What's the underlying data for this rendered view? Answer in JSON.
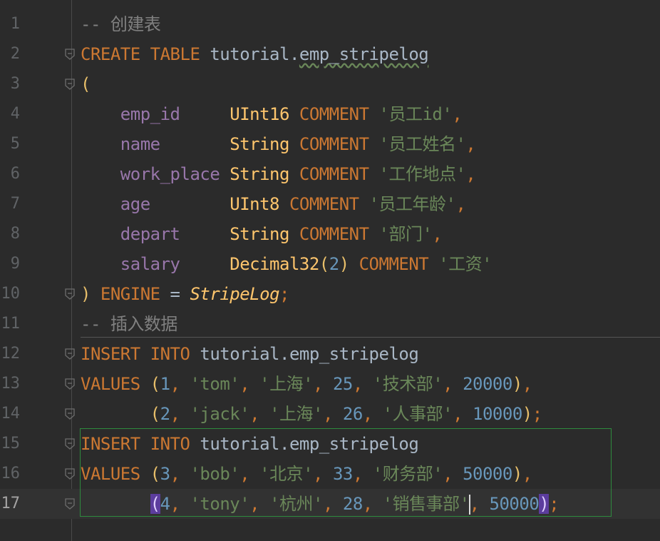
{
  "editor": {
    "current_line": 17,
    "lines": [
      {
        "n": "1",
        "tokens": [
          {
            "c": "cmt",
            "t": "-- 创建表"
          }
        ]
      },
      {
        "n": "2",
        "fold": true,
        "tokens": [
          {
            "c": "kw",
            "t": "CREATE"
          },
          {
            "t": " "
          },
          {
            "c": "kw",
            "t": "TABLE"
          },
          {
            "t": " tutorial."
          },
          {
            "c": "wavy",
            "t": "emp_stripelog"
          }
        ]
      },
      {
        "n": "3",
        "fold": true,
        "tokens": [
          {
            "c": "paren",
            "t": "("
          }
        ]
      },
      {
        "n": "4",
        "tokens": [
          {
            "t": "    "
          },
          {
            "c": "fld",
            "t": "emp_id"
          },
          {
            "t": "     "
          },
          {
            "c": "fn",
            "t": "UInt16"
          },
          {
            "t": " "
          },
          {
            "c": "kw",
            "t": "COMMENT"
          },
          {
            "t": " "
          },
          {
            "c": "str",
            "t": "'员工id'"
          },
          {
            "c": "kw",
            "t": ","
          }
        ]
      },
      {
        "n": "5",
        "tokens": [
          {
            "t": "    "
          },
          {
            "c": "fld",
            "t": "name"
          },
          {
            "t": "       "
          },
          {
            "c": "fn",
            "t": "String"
          },
          {
            "t": " "
          },
          {
            "c": "kw",
            "t": "COMMENT"
          },
          {
            "t": " "
          },
          {
            "c": "str",
            "t": "'员工姓名'"
          },
          {
            "c": "kw",
            "t": ","
          }
        ]
      },
      {
        "n": "6",
        "tokens": [
          {
            "t": "    "
          },
          {
            "c": "fld",
            "t": "work_place"
          },
          {
            "t": " "
          },
          {
            "c": "fn",
            "t": "String"
          },
          {
            "t": " "
          },
          {
            "c": "kw",
            "t": "COMMENT"
          },
          {
            "t": " "
          },
          {
            "c": "str",
            "t": "'工作地点'"
          },
          {
            "c": "kw",
            "t": ","
          }
        ]
      },
      {
        "n": "7",
        "tokens": [
          {
            "t": "    "
          },
          {
            "c": "fld",
            "t": "age"
          },
          {
            "t": "        "
          },
          {
            "c": "fn",
            "t": "UInt8"
          },
          {
            "t": " "
          },
          {
            "c": "kw",
            "t": "COMMENT"
          },
          {
            "t": " "
          },
          {
            "c": "str",
            "t": "'员工年龄'"
          },
          {
            "c": "kw",
            "t": ","
          }
        ]
      },
      {
        "n": "8",
        "tokens": [
          {
            "t": "    "
          },
          {
            "c": "fld",
            "t": "depart"
          },
          {
            "t": "     "
          },
          {
            "c": "fn",
            "t": "String"
          },
          {
            "t": " "
          },
          {
            "c": "kw",
            "t": "COMMENT"
          },
          {
            "t": " "
          },
          {
            "c": "str",
            "t": "'部门'"
          },
          {
            "c": "kw",
            "t": ","
          }
        ]
      },
      {
        "n": "9",
        "tokens": [
          {
            "t": "    "
          },
          {
            "c": "fld",
            "t": "salary"
          },
          {
            "t": "     "
          },
          {
            "c": "fn",
            "t": "Decimal32"
          },
          {
            "c": "paren",
            "t": "("
          },
          {
            "c": "num",
            "t": "2"
          },
          {
            "c": "paren",
            "t": ")"
          },
          {
            "t": " "
          },
          {
            "c": "kw",
            "t": "COMMENT"
          },
          {
            "t": " "
          },
          {
            "c": "str",
            "t": "'工资'"
          }
        ]
      },
      {
        "n": "10",
        "fold": true,
        "tokens": [
          {
            "c": "paren",
            "t": ")"
          },
          {
            "t": " "
          },
          {
            "c": "kw",
            "t": "ENGINE"
          },
          {
            "t": " = "
          },
          {
            "c": "italic-eng",
            "t": "StripeLog"
          },
          {
            "c": "kw",
            "t": ";"
          }
        ]
      },
      {
        "n": "11",
        "tokens": [
          {
            "c": "cmt",
            "t": "-- 插入数据"
          }
        ]
      },
      {
        "n": "12",
        "fold": true,
        "tokens": [
          {
            "c": "kw",
            "t": "INSERT"
          },
          {
            "t": " "
          },
          {
            "c": "kw",
            "t": "INTO"
          },
          {
            "t": " tutorial.emp_stripelog"
          }
        ]
      },
      {
        "n": "13",
        "fold": true,
        "tokens": [
          {
            "c": "kw",
            "t": "VALUES"
          },
          {
            "t": " "
          },
          {
            "c": "paren",
            "t": "("
          },
          {
            "c": "num",
            "t": "1"
          },
          {
            "c": "kw",
            "t": ","
          },
          {
            "t": " "
          },
          {
            "c": "str",
            "t": "'tom'"
          },
          {
            "c": "kw",
            "t": ","
          },
          {
            "t": " "
          },
          {
            "c": "str",
            "t": "'上海'"
          },
          {
            "c": "kw",
            "t": ","
          },
          {
            "t": " "
          },
          {
            "c": "num",
            "t": "25"
          },
          {
            "c": "kw",
            "t": ","
          },
          {
            "t": " "
          },
          {
            "c": "str",
            "t": "'技术部'"
          },
          {
            "c": "kw",
            "t": ","
          },
          {
            "t": " "
          },
          {
            "c": "num",
            "t": "20000"
          },
          {
            "c": "paren",
            "t": ")"
          },
          {
            "c": "kw",
            "t": ","
          }
        ]
      },
      {
        "n": "14",
        "fold": true,
        "tokens": [
          {
            "t": "       "
          },
          {
            "c": "paren",
            "t": "("
          },
          {
            "c": "num",
            "t": "2"
          },
          {
            "c": "kw",
            "t": ","
          },
          {
            "t": " "
          },
          {
            "c": "str",
            "t": "'jack'"
          },
          {
            "c": "kw",
            "t": ","
          },
          {
            "t": " "
          },
          {
            "c": "str",
            "t": "'上海'"
          },
          {
            "c": "kw",
            "t": ","
          },
          {
            "t": " "
          },
          {
            "c": "num",
            "t": "26"
          },
          {
            "c": "kw",
            "t": ","
          },
          {
            "t": " "
          },
          {
            "c": "str",
            "t": "'人事部'"
          },
          {
            "c": "kw",
            "t": ","
          },
          {
            "t": " "
          },
          {
            "c": "num",
            "t": "10000"
          },
          {
            "c": "paren",
            "t": ")"
          },
          {
            "c": "kw",
            "t": ";"
          }
        ]
      },
      {
        "n": "15",
        "fold": true,
        "tokens": [
          {
            "c": "kw",
            "t": "INSERT"
          },
          {
            "t": " "
          },
          {
            "c": "kw",
            "t": "INTO"
          },
          {
            "t": " tutorial.emp_stripelog"
          }
        ]
      },
      {
        "n": "16",
        "fold": true,
        "tokens": [
          {
            "c": "kw",
            "t": "VALUES"
          },
          {
            "t": " "
          },
          {
            "c": "paren",
            "t": "("
          },
          {
            "c": "num",
            "t": "3"
          },
          {
            "c": "kw",
            "t": ","
          },
          {
            "t": " "
          },
          {
            "c": "str",
            "t": "'bob'"
          },
          {
            "c": "kw",
            "t": ","
          },
          {
            "t": " "
          },
          {
            "c": "str",
            "t": "'北京'"
          },
          {
            "c": "kw",
            "t": ","
          },
          {
            "t": " "
          },
          {
            "c": "num",
            "t": "33"
          },
          {
            "c": "kw",
            "t": ","
          },
          {
            "t": " "
          },
          {
            "c": "str",
            "t": "'财务部'"
          },
          {
            "c": "kw",
            "t": ","
          },
          {
            "t": " "
          },
          {
            "c": "num",
            "t": "50000"
          },
          {
            "c": "paren",
            "t": ")"
          },
          {
            "c": "kw",
            "t": ","
          }
        ]
      },
      {
        "n": "17",
        "fold": true,
        "tokens": [
          {
            "t": "       "
          },
          {
            "c": "hlparen",
            "t": "("
          },
          {
            "c": "num",
            "t": "4"
          },
          {
            "c": "kw",
            "t": ","
          },
          {
            "t": " "
          },
          {
            "c": "str",
            "t": "'tony'"
          },
          {
            "c": "kw",
            "t": ","
          },
          {
            "t": " "
          },
          {
            "c": "str",
            "t": "'杭州'"
          },
          {
            "c": "kw",
            "t": ","
          },
          {
            "t": " "
          },
          {
            "c": "num",
            "t": "28"
          },
          {
            "c": "kw",
            "t": ","
          },
          {
            "t": " "
          },
          {
            "c": "str",
            "t": "'销售事部'"
          },
          {
            "c": "caret",
            "t": ""
          },
          {
            "c": "kw",
            "t": ","
          },
          {
            "t": " "
          },
          {
            "c": "num",
            "t": "50000"
          },
          {
            "c": "hlparen",
            "t": ")"
          },
          {
            "c": "kw",
            "t": ";"
          }
        ]
      }
    ]
  }
}
